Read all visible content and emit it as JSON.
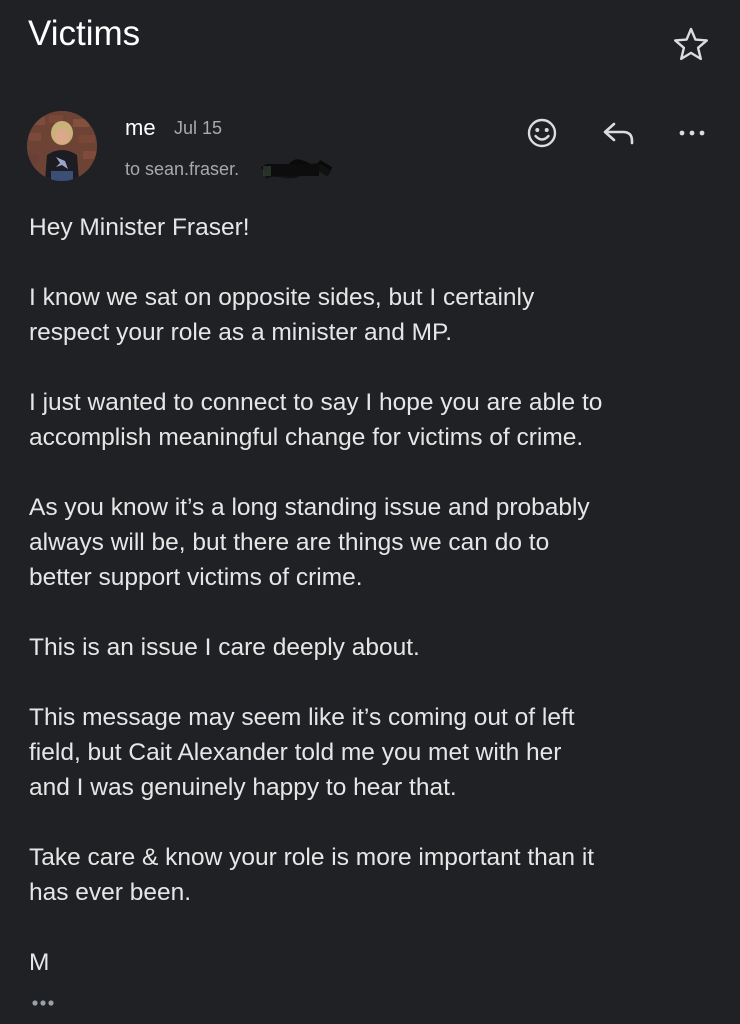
{
  "email": {
    "subject": "Victims",
    "sender": "me",
    "date": "Jul 15",
    "recipient": "to sean.fraser.",
    "body": [
      "Hey Minister Fraser!",
      "I know we sat on opposite sides, but I certainly\n respect your role as a minister and MP.",
      "I just wanted to connect to say I hope you are able to\naccomplish meaningful change for victims of crime.",
      "As you know it’s a long standing issue and probably\nalways will be, but there are things we can do to\nbetter support victims of crime.",
      "This is an issue I care deeply about.",
      "This message may seem like it’s coming out of left\nfield, but Cait Alexander told me you met with her\nand I was genuinely happy to hear that.",
      "Take care & know your role is more important than it\nhas ever been.",
      "M"
    ]
  },
  "icons": {
    "star": "star-outline-icon",
    "react": "smiley-face-icon",
    "reply": "reply-arrow-icon",
    "more": "more-horizontal-icon",
    "trimmed": "ellipsis-icon"
  },
  "colors": {
    "background": "#202124",
    "primary_text": "#ffffff",
    "secondary_text": "#a7a9ad",
    "icon": "#dadce0"
  }
}
